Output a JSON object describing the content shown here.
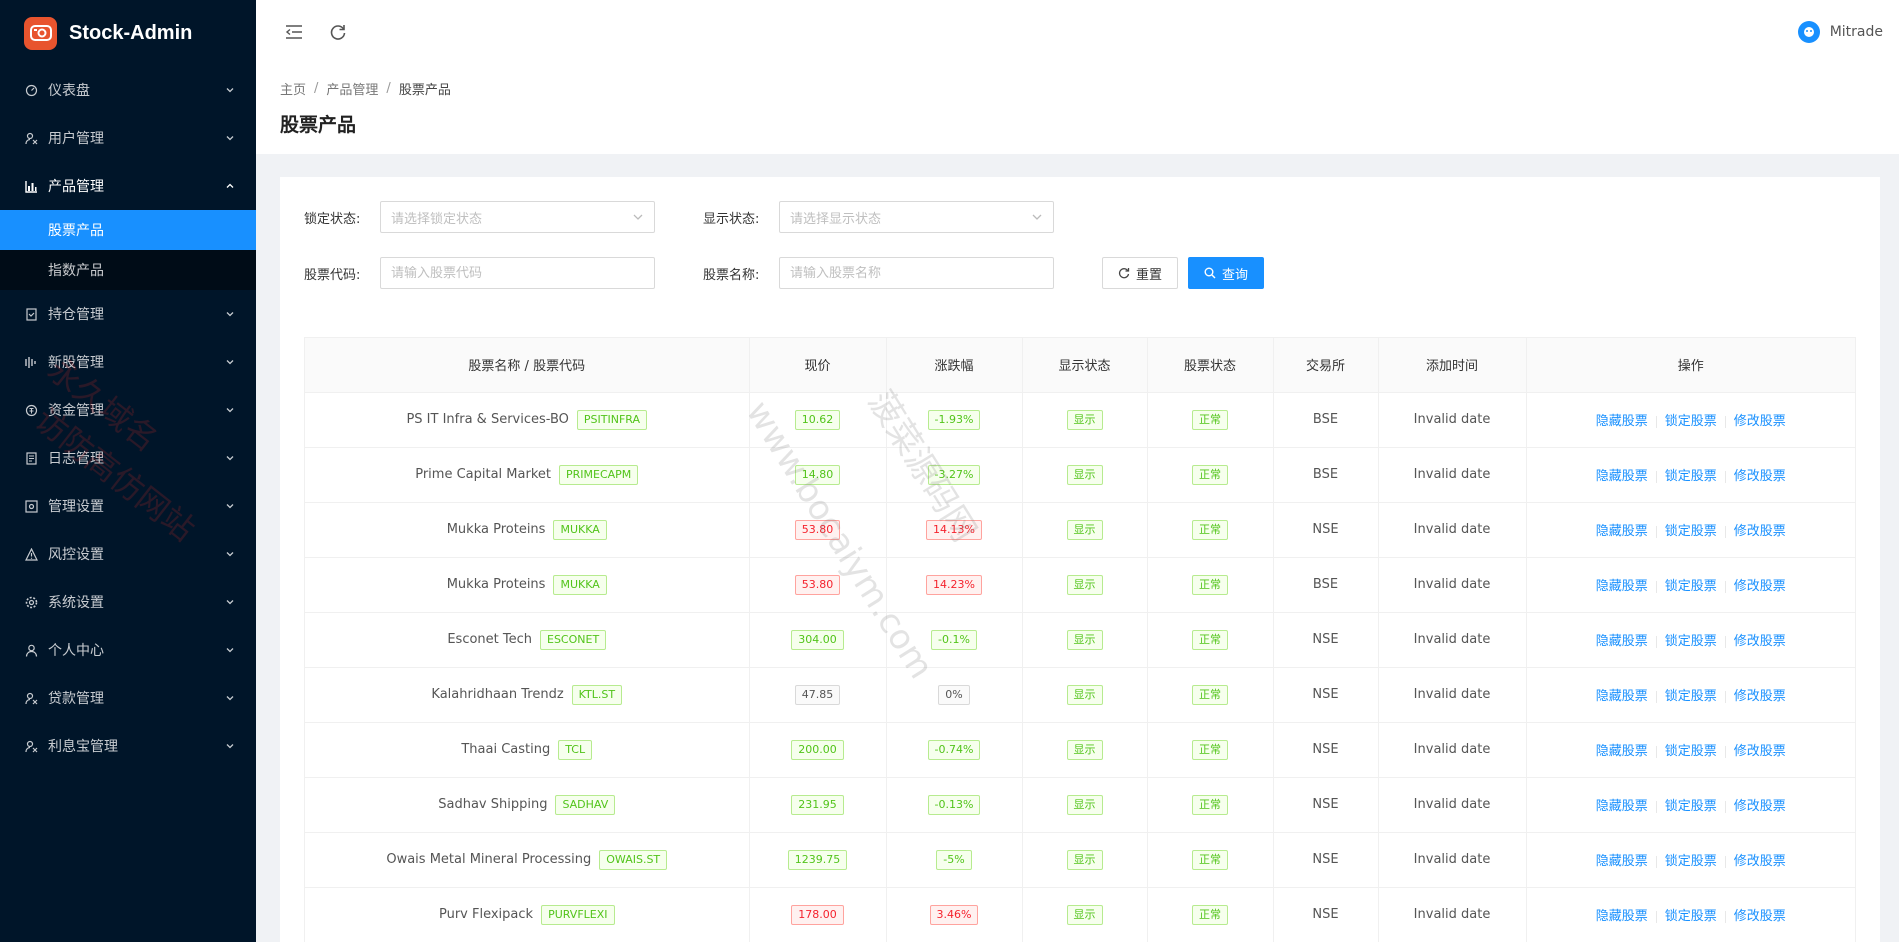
{
  "app": {
    "name": "Stock-Admin"
  },
  "user": {
    "name": "Mitrade"
  },
  "sidebar": {
    "items": [
      {
        "label": "仪表盘",
        "icon": "dashboard-icon"
      },
      {
        "label": "用户管理",
        "icon": "user-manage-icon"
      },
      {
        "label": "产品管理",
        "icon": "chart-icon",
        "open": true,
        "children": [
          {
            "label": "股票产品",
            "active": true
          },
          {
            "label": "指数产品"
          }
        ]
      },
      {
        "label": "持仓管理",
        "icon": "position-icon"
      },
      {
        "label": "新股管理",
        "icon": "ipo-icon"
      },
      {
        "label": "资金管理",
        "icon": "fund-icon"
      },
      {
        "label": "日志管理",
        "icon": "log-icon"
      },
      {
        "label": "管理设置",
        "icon": "settings-box-icon"
      },
      {
        "label": "风控设置",
        "icon": "warning-icon"
      },
      {
        "label": "系统设置",
        "icon": "gear-icon"
      },
      {
        "label": "个人中心",
        "icon": "person-icon"
      },
      {
        "label": "贷款管理",
        "icon": "loan-icon"
      },
      {
        "label": "利息宝管理",
        "icon": "interest-icon"
      }
    ]
  },
  "breadcrumb": [
    "主页",
    "产品管理",
    "股票产品"
  ],
  "page_title": "股票产品",
  "filters": {
    "lock_label": "锁定状态:",
    "lock_placeholder": "请选择锁定状态",
    "show_label": "显示状态:",
    "show_placeholder": "请选择显示状态",
    "code_label": "股票代码:",
    "code_placeholder": "请输入股票代码",
    "name_label": "股票名称:",
    "name_placeholder": "请输入股票名称",
    "reset_label": "重置",
    "query_label": "查询"
  },
  "table": {
    "columns": [
      "股票名称 / 股票代码",
      "现价",
      "涨跌幅",
      "显示状态",
      "股票状态",
      "交易所",
      "添加时间",
      "操作"
    ],
    "actions": [
      "隐藏股票",
      "锁定股票",
      "修改股票"
    ],
    "rows": [
      {
        "name": "PS IT Infra & Services-BO",
        "code": "PSITINFRA",
        "price": "10.62",
        "change": "-1.93%",
        "show": "显示",
        "status": "正常",
        "exchange": "BSE",
        "time": "Invalid date",
        "color": "green"
      },
      {
        "name": "Prime Capital Market",
        "code": "PRIMECAPM",
        "price": "14.80",
        "change": "-3.27%",
        "show": "显示",
        "status": "正常",
        "exchange": "BSE",
        "time": "Invalid date",
        "color": "green"
      },
      {
        "name": "Mukka Proteins",
        "code": "MUKKA",
        "price": "53.80",
        "change": "14.13%",
        "show": "显示",
        "status": "正常",
        "exchange": "NSE",
        "time": "Invalid date",
        "color": "red"
      },
      {
        "name": "Mukka Proteins",
        "code": "MUKKA",
        "price": "53.80",
        "change": "14.23%",
        "show": "显示",
        "status": "正常",
        "exchange": "BSE",
        "time": "Invalid date",
        "color": "red"
      },
      {
        "name": "Esconet Tech",
        "code": "ESCONET",
        "price": "304.00",
        "change": "-0.1%",
        "show": "显示",
        "status": "正常",
        "exchange": "NSE",
        "time": "Invalid date",
        "color": "green"
      },
      {
        "name": "Kalahridhaan Trendz",
        "code": "KTL.ST",
        "price": "47.85",
        "change": "0%",
        "show": "显示",
        "status": "正常",
        "exchange": "NSE",
        "time": "Invalid date",
        "color": "grey"
      },
      {
        "name": "Thaai Casting",
        "code": "TCL",
        "price": "200.00",
        "change": "-0.74%",
        "show": "显示",
        "status": "正常",
        "exchange": "NSE",
        "time": "Invalid date",
        "color": "green"
      },
      {
        "name": "Sadhav Shipping",
        "code": "SADHAV",
        "price": "231.95",
        "change": "-0.13%",
        "show": "显示",
        "status": "正常",
        "exchange": "NSE",
        "time": "Invalid date",
        "color": "green"
      },
      {
        "name": "Owais Metal Mineral Processing",
        "code": "OWAIS.ST",
        "price": "1239.75",
        "change": "-5%",
        "show": "显示",
        "status": "正常",
        "exchange": "NSE",
        "time": "Invalid date",
        "color": "green"
      },
      {
        "name": "Purv Flexipack",
        "code": "PURVFLEXI",
        "price": "178.00",
        "change": "3.46%",
        "show": "显示",
        "status": "正常",
        "exchange": "NSE",
        "time": "Invalid date",
        "color": "red"
      }
    ]
  },
  "watermarks": [
    "永久域名",
    "访防高仿网站",
    "www.bocaiym.com",
    "菠菜源码网"
  ]
}
